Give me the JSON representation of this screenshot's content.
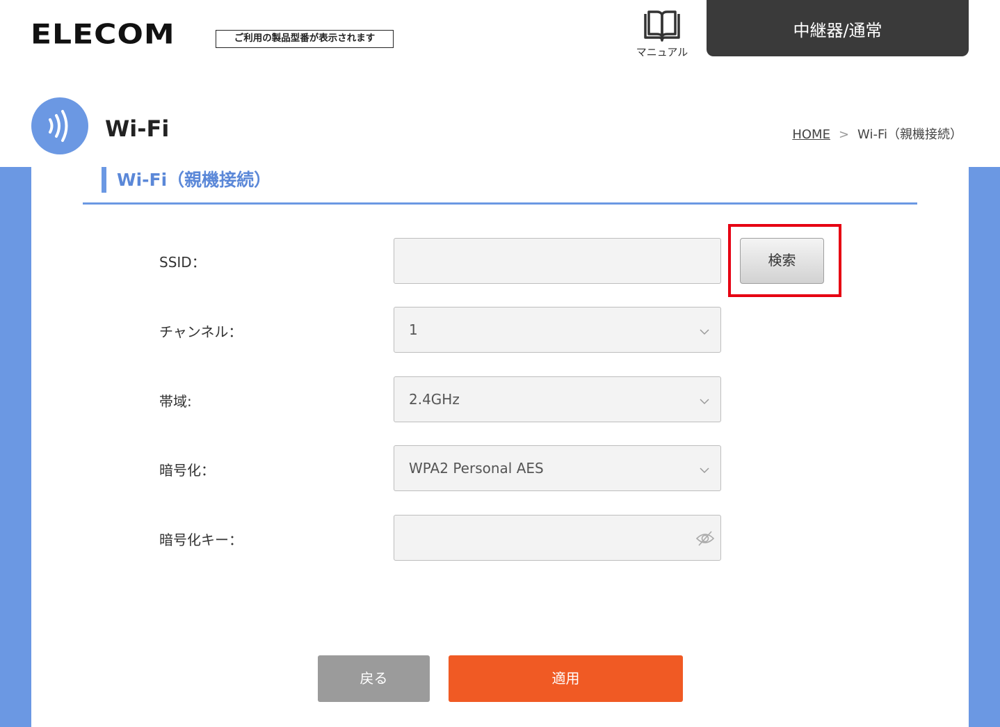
{
  "header": {
    "logo": "ELECOM",
    "model_label": "ご利用の製品型番が表示されます",
    "manual_label": "マニュアル",
    "mode_label": "中継器/通常"
  },
  "page": {
    "title": "Wi-Fi",
    "breadcrumb_home": "HOME",
    "breadcrumb_separator": ">",
    "breadcrumb_current": "Wi-Fi（親機接続）"
  },
  "section": {
    "title": "Wi-Fi（親機接続）"
  },
  "form": {
    "ssid_label": "SSID：",
    "ssid_value": "",
    "search_button": "検索",
    "channel_label": "チャンネル：",
    "channel_value": "1",
    "band_label": "帯域:",
    "band_value": "2.4GHz",
    "encryption_label": "暗号化：",
    "encryption_value": "WPA2 Personal AES",
    "key_label": "暗号化キー：",
    "key_value": ""
  },
  "actions": {
    "back_label": "戻る",
    "apply_label": "適用"
  },
  "icons": {
    "manual": "book-icon",
    "wifi": "wifi-signal-icon",
    "dropdown": "chevron-down-icon",
    "password_toggle": "eye-slash-icon"
  },
  "colors": {
    "accent_blue": "#6b98e3",
    "apply_orange": "#f05a24",
    "back_gray": "#9b9b9b",
    "header_dark": "#3a3a3a",
    "highlight_red": "#e60012"
  }
}
